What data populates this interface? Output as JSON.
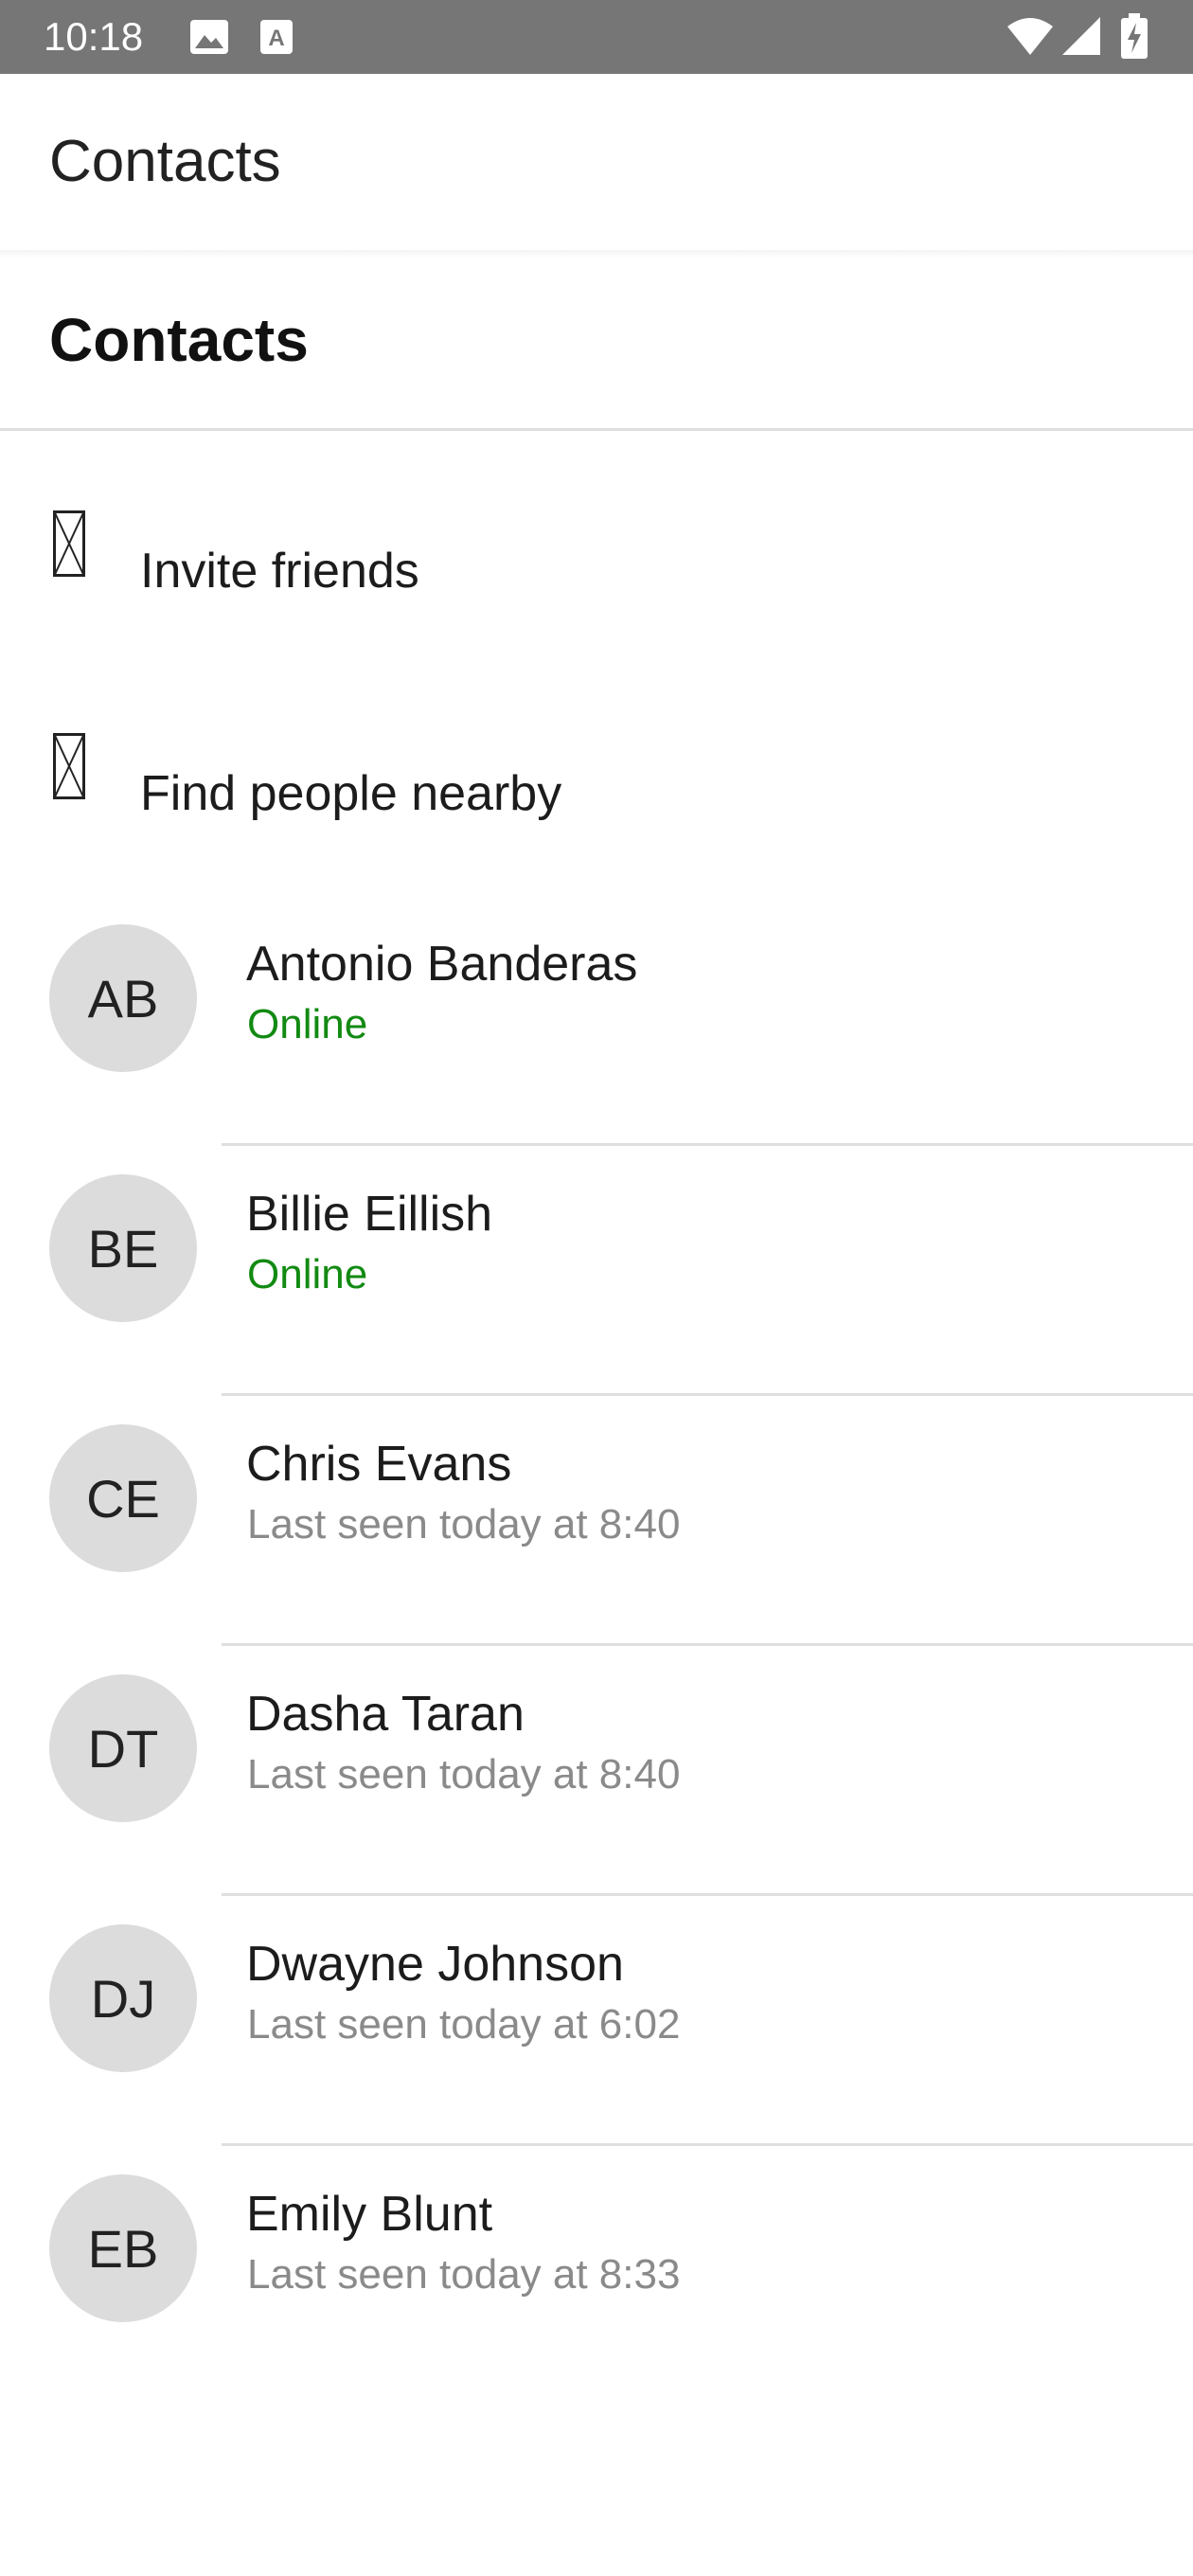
{
  "status_bar": {
    "time": "10:18",
    "icons": [
      "image-icon",
      "font-a-icon",
      "wifi-icon",
      "cell-signal-icon",
      "battery-charging-icon"
    ]
  },
  "app_bar": {
    "title": "Contacts"
  },
  "section": {
    "title": "Contacts"
  },
  "actions": [
    {
      "label": "Invite friends",
      "icon": "placeholder-icon"
    },
    {
      "label": "Find people nearby",
      "icon": "placeholder-icon"
    }
  ],
  "colors": {
    "status_bar_bg": "#767676",
    "online": "#128a12",
    "last_seen": "#8a8a8a",
    "avatar_bg": "#dcdcdc"
  },
  "contacts": [
    {
      "initials": "AB",
      "name": "Antonio Banderas",
      "status": "Online",
      "online": true
    },
    {
      "initials": "BE",
      "name": "Billie Eillish",
      "status": "Online",
      "online": true
    },
    {
      "initials": "CE",
      "name": "Chris Evans",
      "status": "Last seen today at 8:40",
      "online": false
    },
    {
      "initials": "DT",
      "name": "Dasha Taran",
      "status": "Last seen today at 8:40",
      "online": false
    },
    {
      "initials": "DJ",
      "name": "Dwayne Johnson",
      "status": "Last seen today at 6:02",
      "online": false
    },
    {
      "initials": "EB",
      "name": "Emily Blunt",
      "status": "Last seen today at 8:33",
      "online": false
    }
  ]
}
